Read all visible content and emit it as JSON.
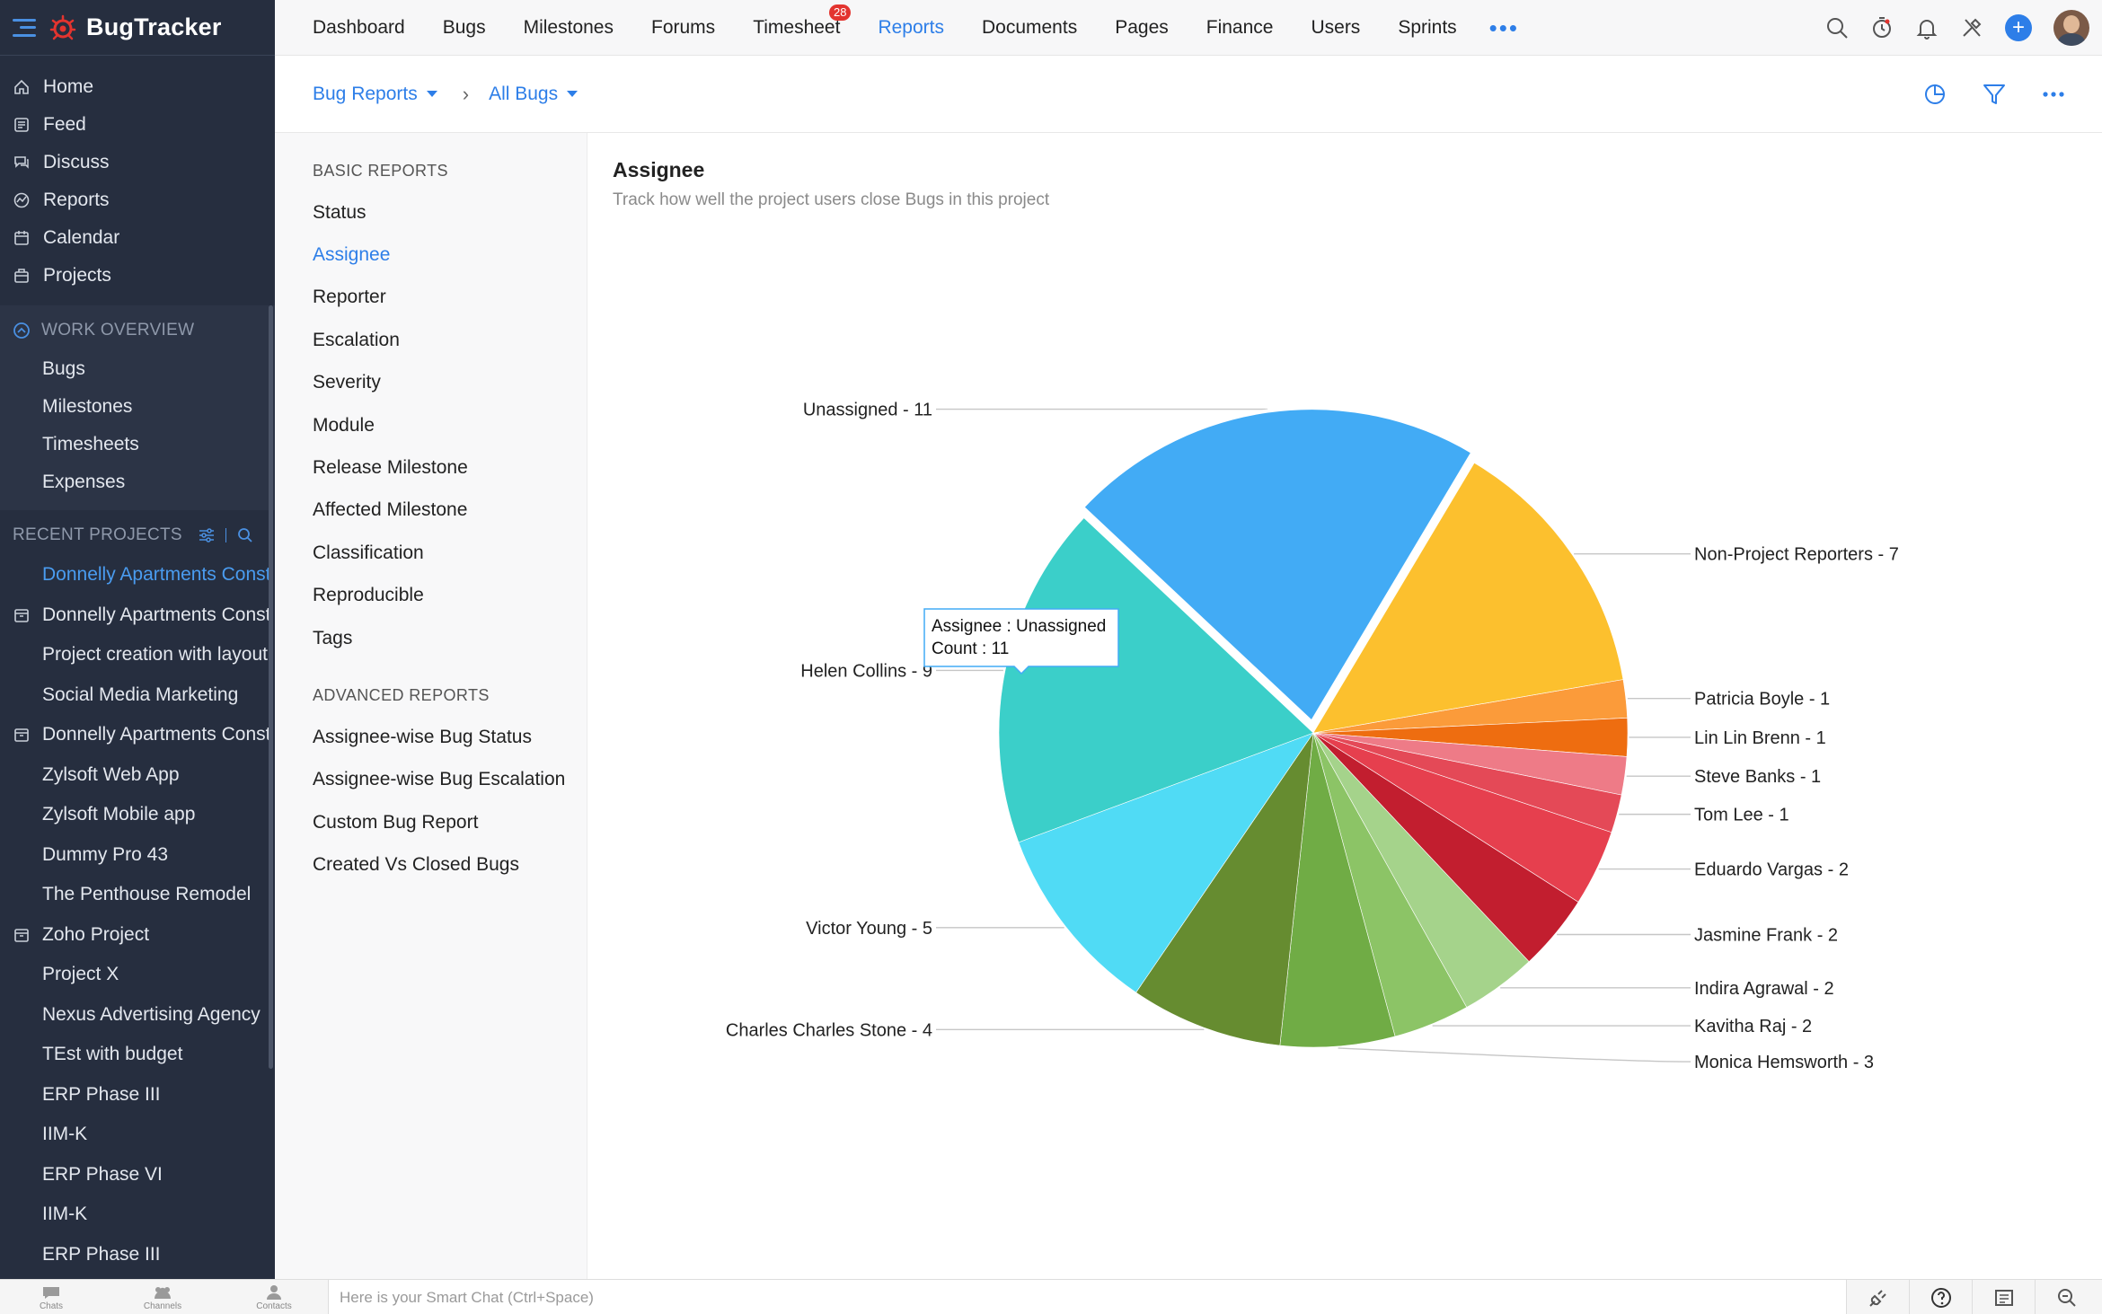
{
  "app": {
    "name": "BugTracker"
  },
  "sidebar": {
    "main": [
      {
        "label": "Home",
        "icon": "home-icon"
      },
      {
        "label": "Feed",
        "icon": "feed-icon"
      },
      {
        "label": "Discuss",
        "icon": "discuss-icon"
      },
      {
        "label": "Reports",
        "icon": "reports-icon"
      },
      {
        "label": "Calendar",
        "icon": "calendar-icon"
      },
      {
        "label": "Projects",
        "icon": "projects-icon"
      }
    ],
    "work_overview": {
      "title": "WORK OVERVIEW",
      "items": [
        "Bugs",
        "Milestones",
        "Timesheets",
        "Expenses"
      ]
    },
    "recent": {
      "title": "RECENT PROJECTS",
      "projects": [
        {
          "label": "Donnelly Apartments Construction",
          "active": true,
          "icon": ""
        },
        {
          "label": "Donnelly Apartments Construction",
          "active": false,
          "icon": "project-box-icon"
        },
        {
          "label": "Project creation with layout",
          "active": false,
          "icon": ""
        },
        {
          "label": "Social Media Marketing",
          "active": false,
          "icon": ""
        },
        {
          "label": "Donnelly Apartments Construction",
          "active": false,
          "icon": "project-box-icon"
        },
        {
          "label": "Zylsoft Web App",
          "active": false,
          "icon": ""
        },
        {
          "label": "Zylsoft Mobile app",
          "active": false,
          "icon": ""
        },
        {
          "label": "Dummy Pro 43",
          "active": false,
          "icon": ""
        },
        {
          "label": "The Penthouse Remodel",
          "active": false,
          "icon": ""
        },
        {
          "label": "Zoho Project",
          "active": false,
          "icon": "project-box-icon"
        },
        {
          "label": "Project X",
          "active": false,
          "icon": ""
        },
        {
          "label": "Nexus Advertising Agency",
          "active": false,
          "icon": ""
        },
        {
          "label": "TEst with budget",
          "active": false,
          "icon": ""
        },
        {
          "label": "ERP Phase III",
          "active": false,
          "icon": ""
        },
        {
          "label": "IIM-K",
          "active": false,
          "icon": ""
        },
        {
          "label": "ERP Phase VI",
          "active": false,
          "icon": ""
        },
        {
          "label": "IIM-K",
          "active": false,
          "icon": ""
        },
        {
          "label": "ERP Phase III",
          "active": false,
          "icon": ""
        }
      ]
    }
  },
  "topnav": {
    "tabs": [
      {
        "label": "Dashboard"
      },
      {
        "label": "Bugs"
      },
      {
        "label": "Milestones"
      },
      {
        "label": "Forums"
      },
      {
        "label": "Timesheet",
        "badge": "28"
      },
      {
        "label": "Reports",
        "active": true
      },
      {
        "label": "Documents"
      },
      {
        "label": "Pages"
      },
      {
        "label": "Finance"
      },
      {
        "label": "Users"
      },
      {
        "label": "Sprints"
      }
    ],
    "more": "•••",
    "plus": "+"
  },
  "breadcrumb": {
    "first": "Bug Reports",
    "second": "All Bugs",
    "sep": "›"
  },
  "reports": {
    "basic_title": "BASIC REPORTS",
    "basic": [
      "Status",
      "Assignee",
      "Reporter",
      "Escalation",
      "Severity",
      "Module",
      "Release Milestone",
      "Affected Milestone",
      "Classification",
      "Reproducible",
      "Tags"
    ],
    "active": "Assignee",
    "advanced_title": "ADVANCED REPORTS",
    "advanced": [
      "Assignee-wise Bug Status",
      "Assignee-wise Bug Escalation",
      "Custom Bug Report",
      "Created Vs Closed Bugs"
    ]
  },
  "report": {
    "title": "Assignee",
    "subtitle": "Track how well the project users close Bugs in this project"
  },
  "chart_data": {
    "type": "pie",
    "title": "",
    "slices": [
      {
        "label": "Patricia Boyle",
        "value": 1,
        "color": "#fb9b3a"
      },
      {
        "label": "Lin Lin Brenn",
        "value": 1,
        "color": "#ee6d10"
      },
      {
        "label": "Steve Banks",
        "value": 1,
        "color": "#ee7b87"
      },
      {
        "label": "Tom Lee",
        "value": 1,
        "color": "#e44957"
      },
      {
        "label": "Eduardo Vargas",
        "value": 2,
        "color": "#e63f4e"
      },
      {
        "label": "Jasmine Frank",
        "value": 2,
        "color": "#c21e2f"
      },
      {
        "label": "Indira Agrawal",
        "value": 2,
        "color": "#a5d38b"
      },
      {
        "label": "Kavitha Raj",
        "value": 2,
        "color": "#8cc466"
      },
      {
        "label": "Monica Hemsworth",
        "value": 3,
        "color": "#70ac45"
      },
      {
        "label": "Charles Charles Stone",
        "value": 4,
        "color": "#668c30"
      },
      {
        "label": "Victor Young",
        "value": 5,
        "color": "#50dbf5"
      },
      {
        "label": "Helen Collins",
        "value": 9,
        "color": "#3bcfc9"
      },
      {
        "label": "Unassigned",
        "value": 11,
        "color": "#42abf5",
        "exploded": true
      },
      {
        "label": "Non-Project Reporters",
        "value": 7,
        "color": "#fcc02e"
      }
    ],
    "tooltip": {
      "line1": "Assignee : Unassigned",
      "line2": "Count : 11"
    }
  },
  "bottombar": {
    "chats": "Chats",
    "channels": "Channels",
    "contacts": "Contacts",
    "placeholder": "Here is your Smart Chat (Ctrl+Space)"
  }
}
